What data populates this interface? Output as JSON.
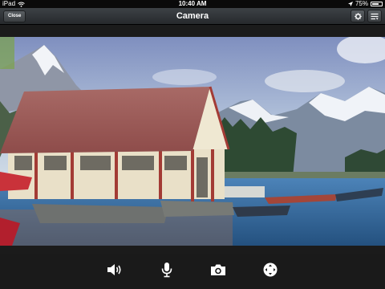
{
  "status_bar": {
    "device": "iPad",
    "time": "10:40 AM",
    "battery": "75%",
    "battery_level": 0.75
  },
  "nav": {
    "close_label": "Close",
    "title": "Camera"
  },
  "toolbar": {
    "icons": [
      "speaker-icon",
      "microphone-icon",
      "camera-icon",
      "pan-control-icon"
    ]
  },
  "colors": {
    "nav_background": "#2e3236",
    "toolbar_background": "#1a1a1a",
    "icon": "#ffffff"
  }
}
